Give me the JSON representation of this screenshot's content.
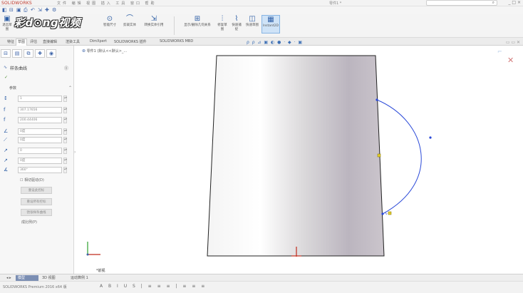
{
  "window": {
    "app_name": "SOLIDWORKS",
    "menu_text": "文件 编辑 视图 插入 工具 窗口 帮助",
    "doc_title": "零件1 *",
    "search_icon": "search-icon",
    "window_controls": "_ □ ×"
  },
  "watermark": "彩d⊙ng视频",
  "toolbar": {
    "tools": [
      {
        "icon": "▣",
        "label": "退出草图"
      },
      {
        "icon": "⊙",
        "label": "智能尺寸"
      },
      {
        "icon": "▭",
        "label": "矩形"
      },
      {
        "icon": "◔",
        "label": "圆"
      },
      {
        "icon": "⌒",
        "label": "剪裁实体"
      },
      {
        "icon": "⇲",
        "label": "转换实体引用"
      },
      {
        "icon": "⇶",
        "label": "镜向实体"
      },
      {
        "icon": "⊞",
        "label": "显示/删除几何关系"
      },
      {
        "icon": "⫶",
        "label": "修复草图"
      },
      {
        "icon": "⌇",
        "label": "快速捕捉"
      },
      {
        "icon": "◫",
        "label": "快速草图"
      },
      {
        "icon": "▦",
        "label": "Instant2D"
      }
    ]
  },
  "tabs": [
    "特征",
    "草图",
    "评估",
    "直接编辑",
    "渲染工具",
    "DimXpert",
    "SOLIDWORKS 插件",
    "SOLIDWORKS MBD"
  ],
  "heads_up": "ρ ρ ⊿ ▣ ◐ ● · ◆ · ▣",
  "property_manager": {
    "title": "样条曲线",
    "section": "参数",
    "params": [
      {
        "icon": "↕",
        "value": "1"
      },
      {
        "icon": "f",
        "value": "307.17656"
      },
      {
        "icon": "f",
        "value": "200.44406"
      },
      {
        "icon": "∠",
        "value": "0度"
      },
      {
        "icon": "⟋",
        "value": "0度"
      },
      {
        "icon": "↗",
        "value": "0"
      },
      {
        "icon": "↗",
        "value": "0度"
      },
      {
        "icon": "∡",
        "value": "360°"
      }
    ],
    "checkbox_label": "相切驱动(D)",
    "buttons": [
      "重设此控标",
      "重设所有控标",
      "弛张样条曲线"
    ],
    "last_option": "成比例(P)"
  },
  "breadcrumb": "零件1 (默认<<默认>_...",
  "view_label": "*前视",
  "bottom_tabs": [
    "模型",
    "3D 视图",
    "运动算例 1"
  ],
  "status_text": "SOLIDWORKS Premium 2016 x64 版",
  "format_bar": "A B I U S | ≡ ≡ ≡ | ≡ ≡ ≡"
}
